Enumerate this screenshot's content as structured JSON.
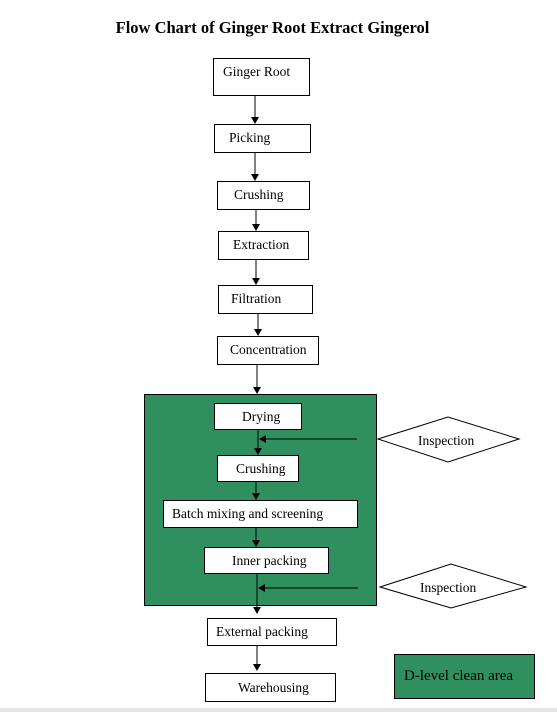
{
  "title": "Flow Chart of Ginger Root Extract Gingerol",
  "steps": [
    {
      "label": "Ginger Root"
    },
    {
      "label": "Picking"
    },
    {
      "label": "Crushing"
    },
    {
      "label": "Extraction"
    },
    {
      "label": "Filtration"
    },
    {
      "label": "Concentration"
    },
    {
      "label": "Drying"
    },
    {
      "label": "Crushing"
    },
    {
      "label": "Batch mixing and screening"
    },
    {
      "label": "Inner packing"
    },
    {
      "label": "External packing"
    },
    {
      "label": "Warehousing"
    }
  ],
  "inspections": [
    {
      "label": "Inspection"
    },
    {
      "label": "Inspection"
    }
  ],
  "legend": {
    "label": "D-level clean area",
    "color": "#2f8f5f"
  }
}
